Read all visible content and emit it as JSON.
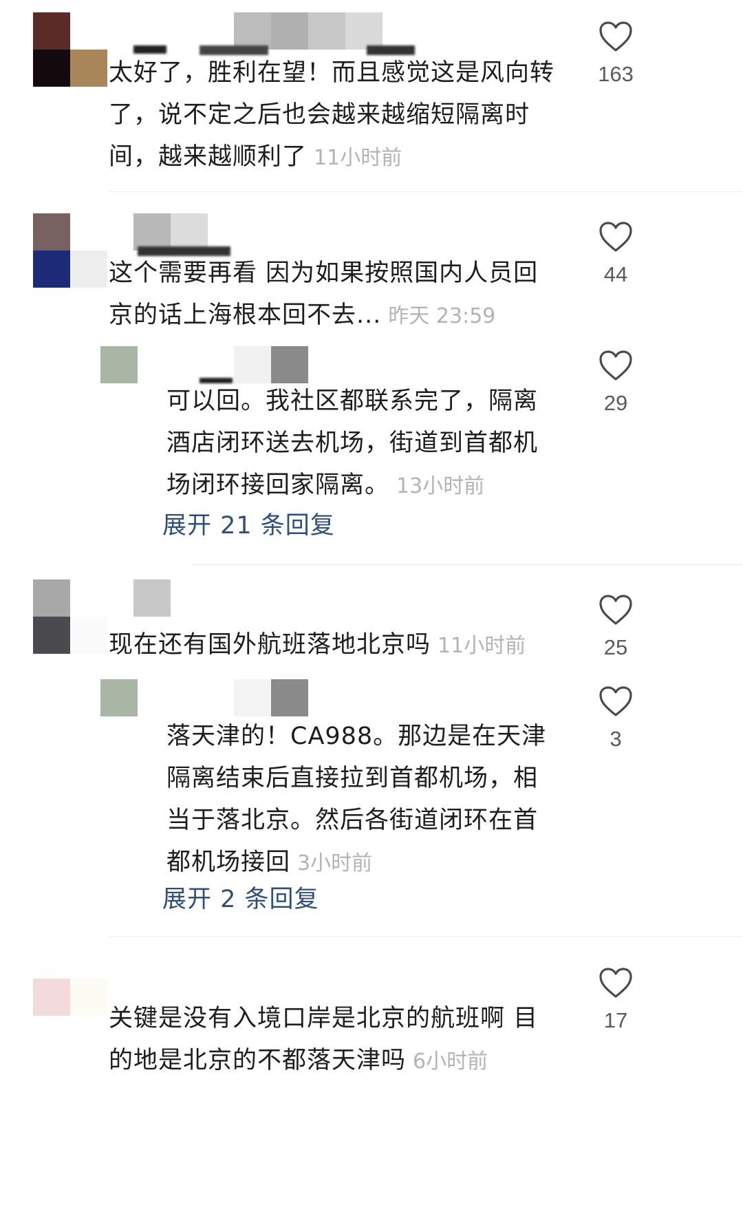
{
  "comments": [
    {
      "text": "太好了，胜利在望！而且感觉这是风向转了，说不定之后也会越来越缩短隔离时间，越来越顺利了",
      "time": "11小时前",
      "likes": "163"
    },
    {
      "text": "这个需要再看 因为如果按照国内人员回京的话上海根本回不去...",
      "time": "昨天 23:59",
      "likes": "44",
      "reply": {
        "text": "可以回。我社区都联系完了，隔离酒店闭环送去机场，街道到首都机场闭环接回家隔离。",
        "time": "13小时前",
        "likes": "29"
      },
      "expand_label": "展开 21 条回复"
    },
    {
      "text": "现在还有国外航班落地北京吗",
      "time": "11小时前",
      "likes": "25",
      "reply": {
        "text": "落天津的！CA988。那边是在天津隔离结束后直接拉到首都机场，相当于落北京。然后各街道闭环在首都机场接回",
        "time": "3小时前",
        "likes": "3"
      },
      "expand_label": "展开 2 条回复"
    },
    {
      "text": "关键是没有入境口岸是北京的航班啊 目的地是北京的不都落天津吗",
      "time": "6小时前",
      "likes": "17"
    }
  ],
  "icons": {
    "like": "heart-outline-icon"
  },
  "colors": {
    "expand_link": "#2f4f7b",
    "meta": "#b3b3b3",
    "text": "#1e1e1e"
  }
}
